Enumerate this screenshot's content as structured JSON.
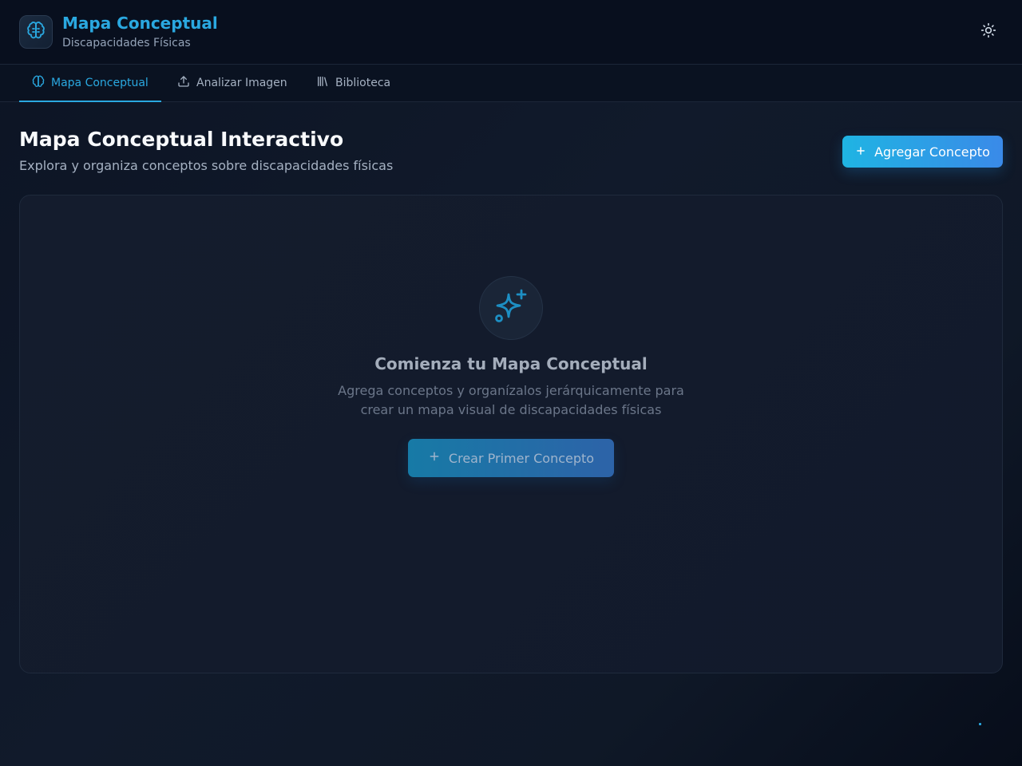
{
  "header": {
    "title": "Mapa Conceptual",
    "subtitle": "Discapacidades Físicas",
    "logo_icon": "brain-icon",
    "theme_icon": "sun-icon"
  },
  "tabs": [
    {
      "label": "Mapa Conceptual",
      "icon": "brain-icon",
      "active": true
    },
    {
      "label": "Analizar Imagen",
      "icon": "upload-icon",
      "active": false
    },
    {
      "label": "Biblioteca",
      "icon": "library-icon",
      "active": false
    }
  ],
  "main": {
    "title": "Mapa Conceptual Interactivo",
    "subtitle": "Explora y organiza conceptos sobre discapacidades físicas",
    "add_button_label": "Agregar Concepto"
  },
  "empty_state": {
    "icon": "sparkles-icon",
    "title": "Comienza tu Mapa Conceptual",
    "description": "Agrega conceptos y organízalos jerárquicamente para crear un mapa visual de discapacidades físicas",
    "button_label": "Crear Primer Concepto"
  },
  "colors": {
    "accent": "#2aa8e0",
    "background": "#111a2b",
    "button_gradient_start": "#1fb4e3",
    "button_gradient_end": "#3a8ae8"
  }
}
